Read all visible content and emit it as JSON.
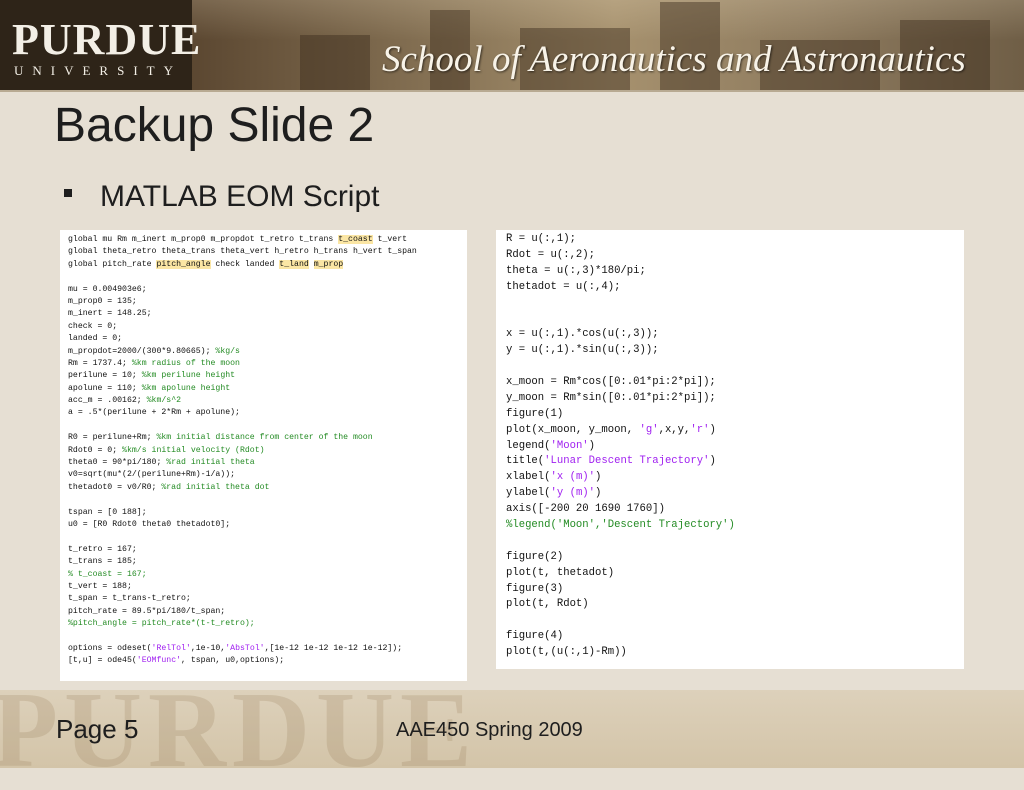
{
  "header": {
    "logo_main": "PURDUE",
    "logo_sub": "UNIVERSITY",
    "school": "School of Aeronautics and Astronautics"
  },
  "slide": {
    "title": "Backup Slide 2",
    "bullet": "MATLAB EOM Script"
  },
  "code_left": [
    [
      {
        "t": "global mu Rm m_inert m_prop0 m_propdot t_retro t_trans "
      },
      {
        "t": "t_coast",
        "c": "hl"
      },
      {
        "t": " t_vert"
      }
    ],
    [
      {
        "t": "global theta_retro theta_trans theta_vert h_retro h_trans h_vert t_span"
      }
    ],
    [
      {
        "t": "global pitch_rate "
      },
      {
        "t": "pitch_angle",
        "c": "hl"
      },
      {
        "t": " check landed "
      },
      {
        "t": "t_land",
        "c": "hl"
      },
      {
        "t": " "
      },
      {
        "t": "m_prop",
        "c": "hl"
      }
    ],
    [],
    [
      {
        "t": "mu = 0.004903e6;"
      }
    ],
    [
      {
        "t": "m_prop0 = 135;"
      }
    ],
    [
      {
        "t": "m_inert = 148.25;"
      }
    ],
    [
      {
        "t": "check = 0;"
      }
    ],
    [
      {
        "t": "landed = 0;"
      }
    ],
    [
      {
        "t": "m_propdot=2000/(300*9.80665); "
      },
      {
        "t": "%kg/s",
        "c": "cm"
      }
    ],
    [
      {
        "t": "Rm = 1737.4; "
      },
      {
        "t": "%km radius of the moon",
        "c": "cm"
      }
    ],
    [
      {
        "t": "perilune = 10; "
      },
      {
        "t": "%km perilune height",
        "c": "cm"
      }
    ],
    [
      {
        "t": "apolune = 110; "
      },
      {
        "t": "%km apolune height",
        "c": "cm"
      }
    ],
    [
      {
        "t": "acc_m = .00162; "
      },
      {
        "t": "%km/s^2",
        "c": "cm"
      }
    ],
    [
      {
        "t": "a = .5*(perilune + 2*Rm + apolune);"
      }
    ],
    [],
    [
      {
        "t": "R0 = perilune+Rm; "
      },
      {
        "t": "%km initial distance from center of the moon",
        "c": "cm"
      }
    ],
    [
      {
        "t": "Rdot0 = 0; "
      },
      {
        "t": "%km/s initial velocity (Rdot)",
        "c": "cm"
      }
    ],
    [
      {
        "t": "theta0 = 90*pi/180; "
      },
      {
        "t": "%rad initial theta",
        "c": "cm"
      }
    ],
    [
      {
        "t": "v0=sqrt(mu*(2/(perilune+Rm)-1/a));"
      }
    ],
    [
      {
        "t": "thetadot0 = v0/R0; "
      },
      {
        "t": "%rad initial theta dot",
        "c": "cm"
      }
    ],
    [],
    [
      {
        "t": "tspan = [0 188];"
      }
    ],
    [
      {
        "t": "u0 = [R0 Rdot0 theta0 thetadot0];"
      }
    ],
    [],
    [
      {
        "t": "t_retro = 167;"
      }
    ],
    [
      {
        "t": "t_trans = 185;"
      }
    ],
    [
      {
        "t": "% t_coast = 167;",
        "c": "cm"
      }
    ],
    [
      {
        "t": "t_vert = 188;"
      }
    ],
    [
      {
        "t": "t_span = t_trans-t_retro;"
      }
    ],
    [
      {
        "t": "pitch_rate = 89.5*pi/180/t_span;"
      }
    ],
    [
      {
        "t": "%pitch_angle = pitch_rate*(t-t_retro);",
        "c": "cm"
      }
    ],
    [],
    [
      {
        "t": "options = odeset("
      },
      {
        "t": "'RelTol'",
        "c": "str"
      },
      {
        "t": ",1e-10,"
      },
      {
        "t": "'AbsTol'",
        "c": "str"
      },
      {
        "t": ",[1e-12 1e-12 1e-12 1e-12]);"
      }
    ],
    [
      {
        "t": "[t,u] = ode45("
      },
      {
        "t": "'EOMfunc'",
        "c": "str"
      },
      {
        "t": ", tspan, u0,options);"
      }
    ]
  ],
  "code_right": [
    [
      {
        "t": "R = u(:,1);"
      }
    ],
    [
      {
        "t": "Rdot = u(:,2);"
      }
    ],
    [
      {
        "t": "theta = u(:,3)*180/pi;"
      }
    ],
    [
      {
        "t": "thetadot = u(:,4);"
      }
    ],
    [],
    [],
    [
      {
        "t": "x = u(:,1).*cos(u(:,3));"
      }
    ],
    [
      {
        "t": "y = u(:,1).*sin(u(:,3));"
      }
    ],
    [],
    [
      {
        "t": "x_moon = Rm*cos([0:.01*pi:2*pi]);"
      }
    ],
    [
      {
        "t": "y_moon = Rm*sin([0:.01*pi:2*pi]);"
      }
    ],
    [
      {
        "t": "figure(1)"
      }
    ],
    [
      {
        "t": "plot(x_moon, y_moon, "
      },
      {
        "t": "'g'",
        "c": "str"
      },
      {
        "t": ",x,y,"
      },
      {
        "t": "'r'",
        "c": "str"
      },
      {
        "t": ")"
      }
    ],
    [
      {
        "t": "legend("
      },
      {
        "t": "'Moon'",
        "c": "str"
      },
      {
        "t": ")"
      }
    ],
    [
      {
        "t": "title("
      },
      {
        "t": "'Lunar Descent Trajectory'",
        "c": "str"
      },
      {
        "t": ")"
      }
    ],
    [
      {
        "t": "xlabel("
      },
      {
        "t": "'x (m)'",
        "c": "str"
      },
      {
        "t": ")"
      }
    ],
    [
      {
        "t": "ylabel("
      },
      {
        "t": "'y (m)'",
        "c": "str"
      },
      {
        "t": ")"
      }
    ],
    [
      {
        "t": "axis([-200 20 1690 1760])"
      }
    ],
    [
      {
        "t": "%legend('Moon','Descent Trajectory')",
        "c": "cm"
      }
    ],
    [],
    [
      {
        "t": "figure(2)"
      }
    ],
    [
      {
        "t": "plot(t, thetadot)"
      }
    ],
    [
      {
        "t": "figure(3)"
      }
    ],
    [
      {
        "t": "plot(t, Rdot)"
      }
    ],
    [],
    [
      {
        "t": "figure(4)"
      }
    ],
    [
      {
        "t": "plot(t,(u(:,1)-Rm))"
      }
    ]
  ],
  "footer": {
    "page_label": "Page 5",
    "course": "AAE450 Spring 2009",
    "watermark": "PURDUE"
  }
}
